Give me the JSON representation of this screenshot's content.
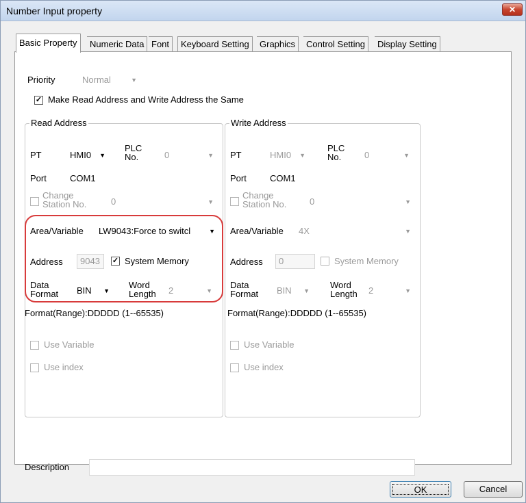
{
  "window": {
    "title": "Number Input property",
    "close_glyph": "✕"
  },
  "tabs": [
    "Basic Property",
    "Numeric Data",
    "Font",
    "Keyboard Setting",
    "Graphics",
    "Control Setting",
    "Display Setting"
  ],
  "priority": {
    "label": "Priority",
    "value": "Normal"
  },
  "same_address": {
    "label": "Make Read Address and Write Address the Same",
    "checked": true
  },
  "read": {
    "title": "Read Address",
    "pt_label": "PT",
    "pt_value": "HMI0",
    "plc_label_1": "PLC",
    "plc_label_2": "No.",
    "plc_value": "0",
    "port_label": "Port",
    "port_value": "COM1",
    "station_label_1": "Change",
    "station_label_2": "Station No.",
    "station_value": "0",
    "area_label": "Area/Variable",
    "area_value": "LW9043:Force to switcl",
    "address_label": "Address",
    "address_value": "9043",
    "sysmem_label": "System Memory",
    "sysmem_checked": true,
    "data_label_1": "Data",
    "data_label_2": "Format",
    "data_value": "BIN",
    "word_label_1": "Word",
    "word_label_2": "Length",
    "word_value": "2",
    "format_range": "Format(Range):DDDDD (1--65535)",
    "use_variable": "Use Variable",
    "use_index": "Use index"
  },
  "write": {
    "title": "Write Address",
    "pt_label": "PT",
    "pt_value": "HMI0",
    "plc_label_1": "PLC",
    "plc_label_2": "No.",
    "plc_value": "0",
    "port_label": "Port",
    "port_value": "COM1",
    "station_label_1": "Change",
    "station_label_2": "Station No.",
    "station_value": "0",
    "area_label": "Area/Variable",
    "area_value": "4X",
    "address_label": "Address",
    "address_value": "0",
    "sysmem_label": "System Memory",
    "data_label_1": "Data",
    "data_label_2": "Format",
    "data_value": "BIN",
    "word_label_1": "Word",
    "word_label_2": "Length",
    "word_value": "2",
    "format_range": "Format(Range):DDDDD (1--65535)",
    "use_variable": "Use Variable",
    "use_index": "Use index"
  },
  "description": {
    "label": "Description",
    "value": ""
  },
  "buttons": {
    "ok": "OK",
    "cancel": "Cancel"
  },
  "glyphs": {
    "dropdown": "▼",
    "check": "✓"
  }
}
